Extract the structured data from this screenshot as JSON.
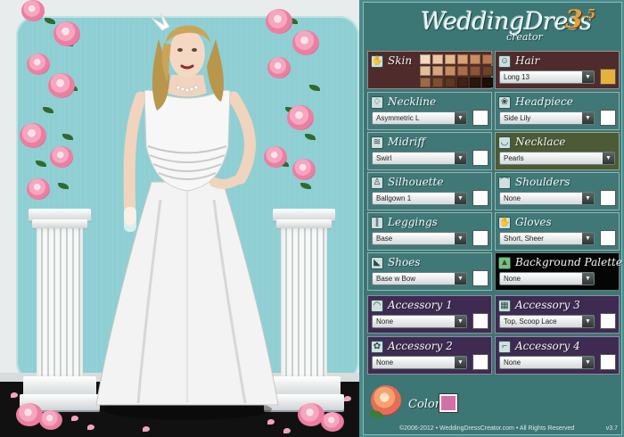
{
  "app": {
    "logo_title": "WeddingDress",
    "logo_subtitle": "creator",
    "logo_version": "3",
    "logo_version_sup": ".5"
  },
  "options": {
    "skin": {
      "label": "Skin",
      "icon": "skin-icon",
      "palette": [
        "#f6d8c2",
        "#efc5a3",
        "#e8b98c",
        "#dba274",
        "#c98e62",
        "#b57a52",
        "#e2be9a",
        "#d6a57c",
        "#c48d63",
        "#a86d45",
        "#8a5635",
        "#6d4229",
        "#9c6a48",
        "#7d4e2f",
        "#5e3820",
        "#3e2414",
        "#2a180d",
        "#1a0e07"
      ]
    },
    "hair": {
      "label": "Hair",
      "icon": "hair-icon",
      "value": "Long 13",
      "color": "#e6b23a"
    },
    "neckline": {
      "label": "Neckline",
      "icon": "neckline-icon",
      "value": "Asymmetric L",
      "color": "#ffffff"
    },
    "headpiece": {
      "label": "Headpiece",
      "icon": "headpiece-icon",
      "value": "Side Lily",
      "color": "#ffffff"
    },
    "midriff": {
      "label": "Midriff",
      "icon": "midriff-icon",
      "value": "Swirl",
      "color": "#ffffff"
    },
    "necklace": {
      "label": "Necklace",
      "icon": "necklace-icon",
      "value": "Pearls"
    },
    "silhouette": {
      "label": "Silhouette",
      "icon": "silhouette-icon",
      "value": "Ballgown 1",
      "color": "#ffffff"
    },
    "shoulders": {
      "label": "Shoulders",
      "icon": "shoulders-icon",
      "value": "None",
      "color": "#ffffff"
    },
    "leggings": {
      "label": "Leggings",
      "icon": "leggings-icon",
      "value": "Base",
      "color": "#ffffff"
    },
    "gloves": {
      "label": "Gloves",
      "icon": "gloves-icon",
      "value": "Short, Sheer",
      "color": "#ffffff"
    },
    "shoes": {
      "label": "Shoes",
      "icon": "shoes-icon",
      "value": "Base w Bow",
      "color": "#ffffff"
    },
    "background_palette": {
      "label": "Background Palette",
      "icon": "background-palette-icon",
      "value": "None"
    },
    "accessory1": {
      "label": "Accessory 1",
      "icon": "accessory1-icon",
      "value": "None",
      "color": "#ffffff"
    },
    "accessory3": {
      "label": "Accessory 3",
      "icon": "accessory3-icon",
      "value": "Top, Scoop Lace",
      "color": "#ffffff"
    },
    "accessory2": {
      "label": "Accessory 2",
      "icon": "accessory2-icon",
      "value": "None",
      "color": "#ffffff"
    },
    "accessory4": {
      "label": "Accessory 4",
      "icon": "accessory4-icon",
      "value": "None",
      "color": "#ffffff"
    }
  },
  "color_picker": {
    "label": "Color",
    "value": "#d36fa9"
  },
  "footer": {
    "copyright": "©2006-2012 • WeddingDressCreator.com • All Rights Reserved",
    "version": "v3.7"
  }
}
